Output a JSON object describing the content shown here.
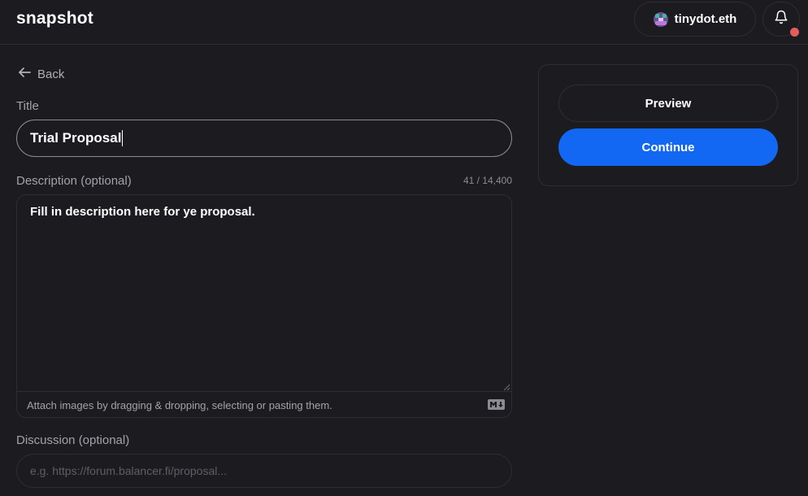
{
  "header": {
    "logo": "snapshot",
    "account_name": "tinydot.eth"
  },
  "form": {
    "back_label": "Back",
    "title_label": "Title",
    "title_value": "Trial Proposal",
    "description_label": "Description (optional)",
    "description_counter": "41 / 14,400",
    "description_value": "Fill in description here for ye proposal.",
    "attach_hint": "Attach images by dragging & dropping, selecting or pasting them.",
    "discussion_label": "Discussion (optional)",
    "discussion_placeholder": "e.g. https://forum.balancer.fi/proposal..."
  },
  "sidebar": {
    "preview_label": "Preview",
    "continue_label": "Continue"
  },
  "colors": {
    "background": "#1c1b20",
    "border": "#2d2d32",
    "accent": "#1268f2",
    "notification": "#e35d5a"
  },
  "icons": {
    "back": "arrow-left-icon",
    "notifications": "bell-icon",
    "markdown": "markdown-icon",
    "avatar": "avatar-icon"
  }
}
